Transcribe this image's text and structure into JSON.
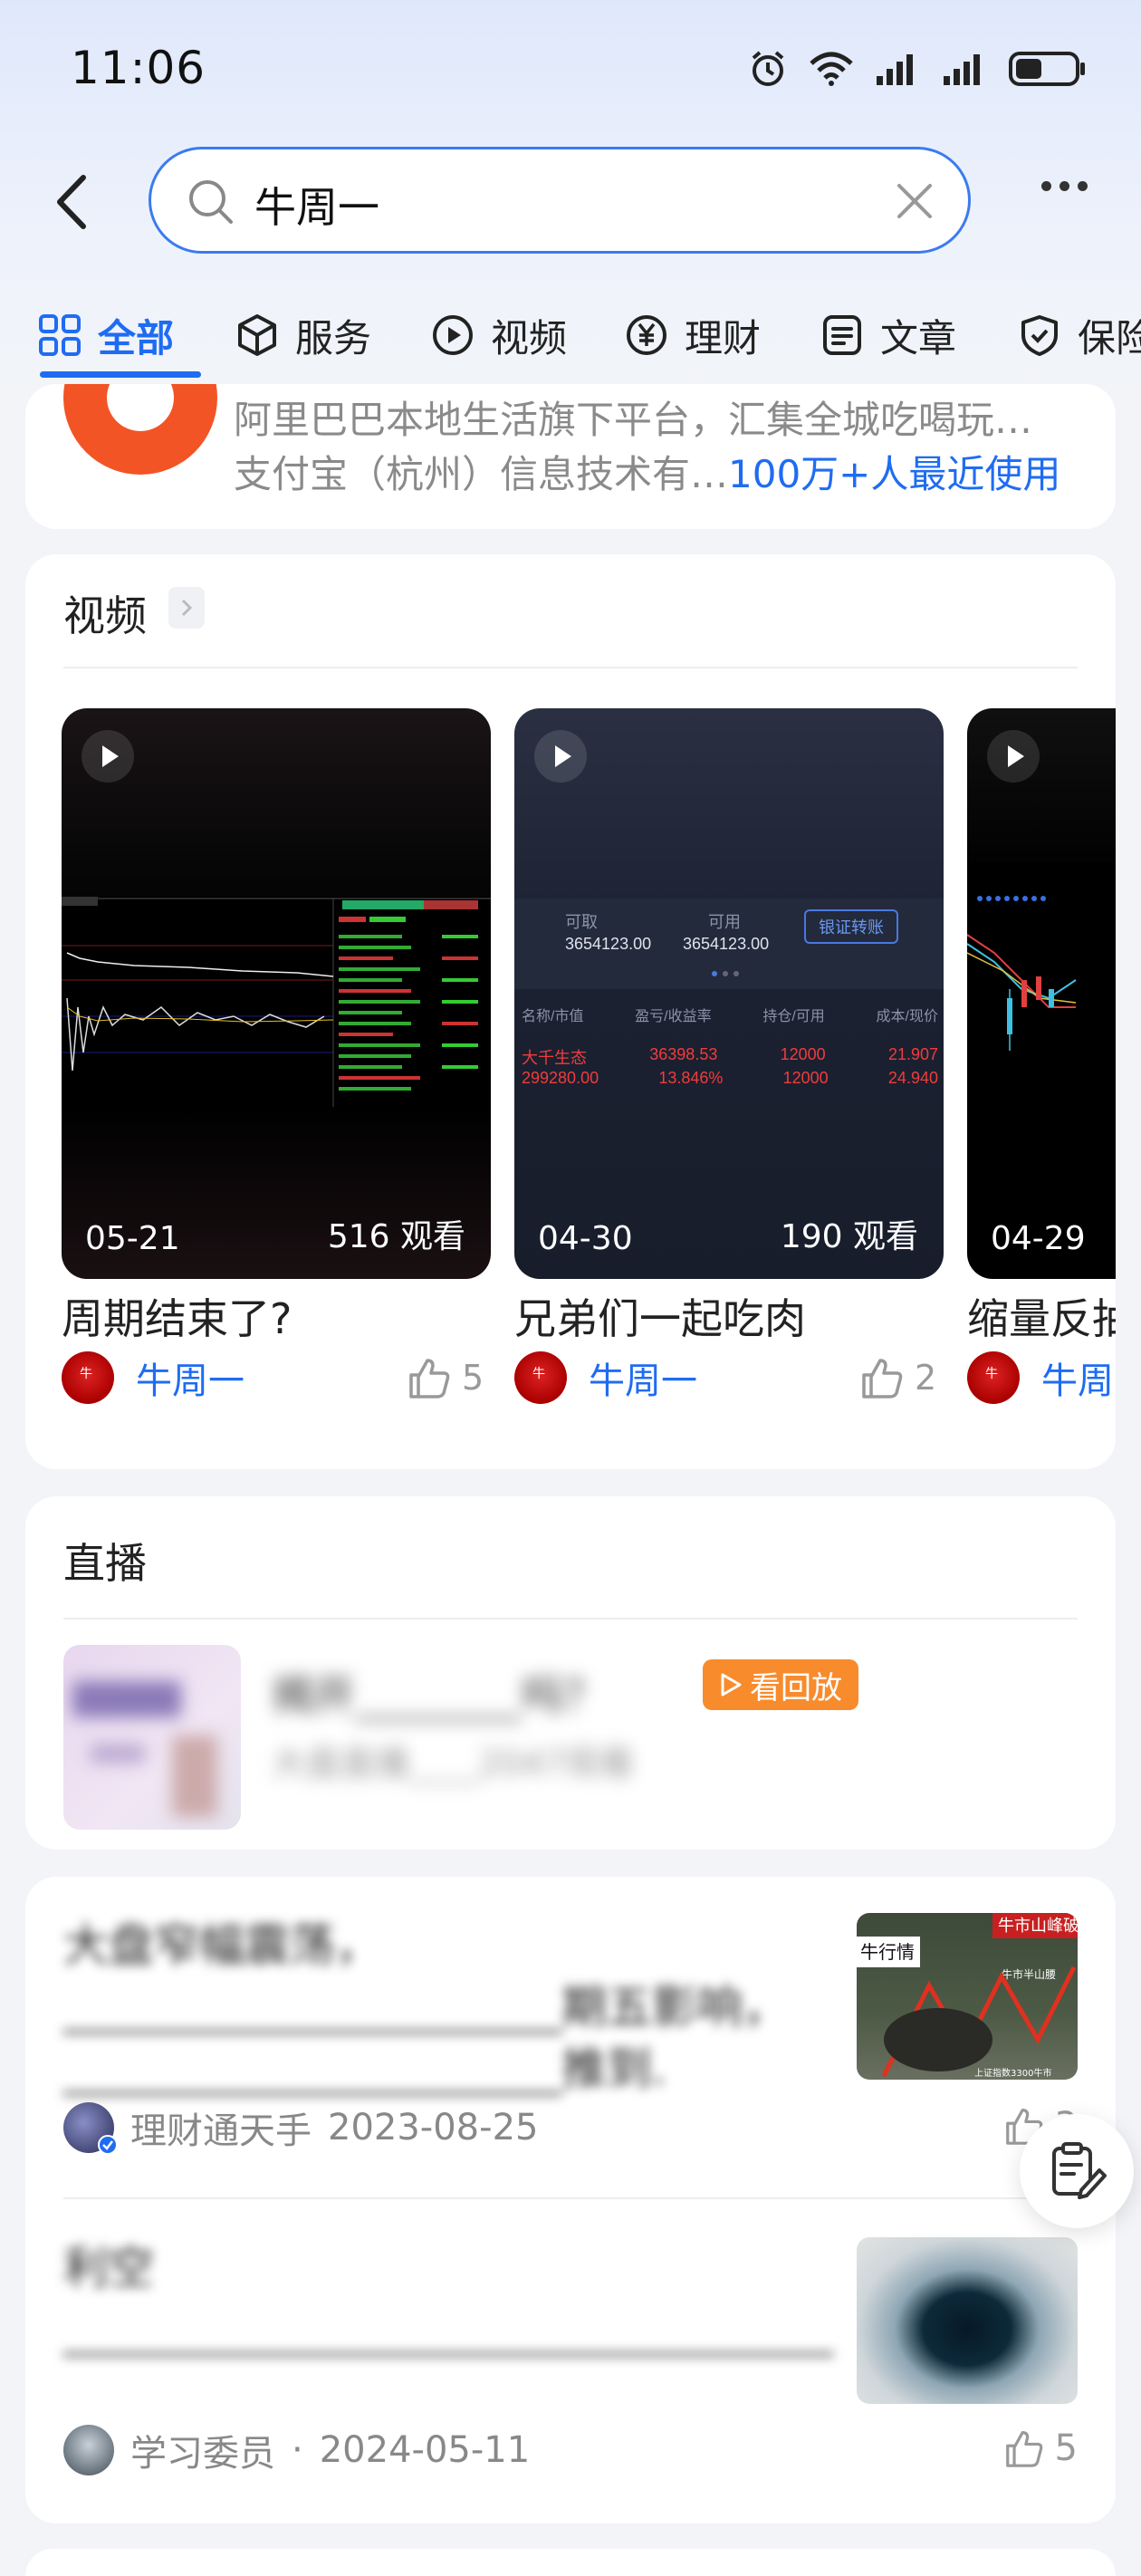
{
  "status_bar": {
    "time": "11:06"
  },
  "search": {
    "query": "牛周一"
  },
  "tabs": [
    {
      "label": "全部",
      "icon": "grid-icon"
    },
    {
      "label": "服务",
      "icon": "cube-icon"
    },
    {
      "label": "视频",
      "icon": "play-circle-icon"
    },
    {
      "label": "理财",
      "icon": "yen-circle-icon"
    },
    {
      "label": "文章",
      "icon": "document-icon"
    },
    {
      "label": "保险",
      "icon": "shield-icon"
    }
  ],
  "app_card": {
    "desc": "阿里巴巴本地生活旗下平台，汇集全城吃喝玩…",
    "company": "支付宝（杭州）信息技术有…",
    "users": "100万+人最近使用"
  },
  "video_section": {
    "title": "视频",
    "videos": [
      {
        "date": "05-21",
        "views": "516 观看",
        "title": "周期结束了?",
        "author": "牛周一",
        "likes": "5"
      },
      {
        "date": "04-30",
        "views": "190 观看",
        "title": "兄弟们一起吃肉",
        "author": "牛周一",
        "likes": "2"
      },
      {
        "date": "04-29",
        "views": "",
        "title": "缩量反抽",
        "author": "牛周",
        "likes": ""
      }
    ],
    "thumb2": {
      "label_1": "可取",
      "label_2": "可用",
      "val_1": "3654123.00",
      "val_2": "3654123.00",
      "button": "银证转账",
      "headers": [
        "名称/市值",
        "盈亏/收益率",
        "持仓/可用",
        "成本/现价"
      ],
      "row_1": [
        "大千生态",
        "36398.53",
        "12000",
        "21.907"
      ],
      "row_2": [
        "299280.00",
        "13.846%",
        "12000",
        "24.940"
      ]
    },
    "thumb3": {
      "label": "牛市山峰破万"
    }
  },
  "live_section": {
    "title": "直播",
    "item_title": "揭开________吗？",
    "badge": "看回放",
    "sub": "大盘直播____2047观看"
  },
  "articles": [
    {
      "title": "大盘窄幅震荡，______________________期五影响，______________________推到.",
      "author": "理财通天手",
      "date": "2023-08-25",
      "likes": "3",
      "thumb_labels": [
        "牛市山峰破万",
        "牛行情",
        "牛市半山腰",
        "上证指数3300牛市"
      ]
    },
    {
      "title": "利空__________________________________",
      "author": "学习委员",
      "date": "2024-05-11",
      "likes": "5"
    }
  ],
  "colors": {
    "accent": "#1f6cf2",
    "badge": "#f88b2c",
    "app_logo": "#f35425"
  }
}
